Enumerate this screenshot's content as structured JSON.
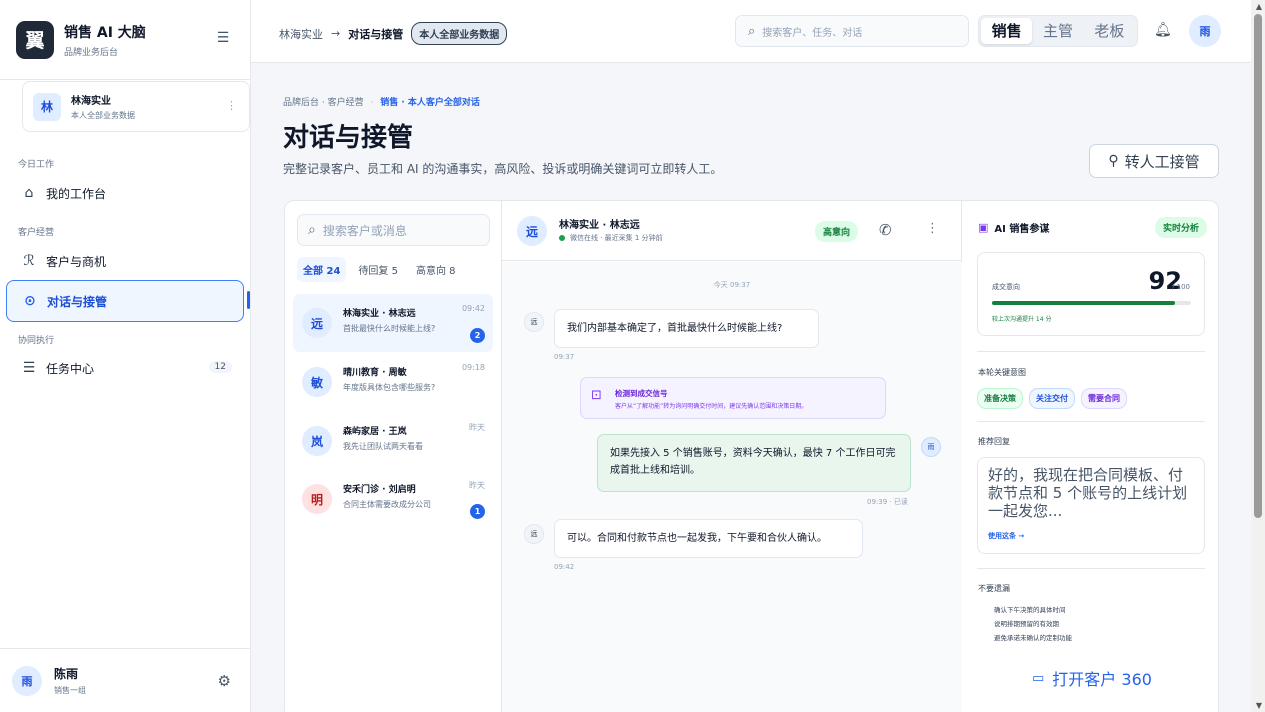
{
  "brand": {
    "logo": "翼",
    "title": "销售 AI 大脑",
    "subtitle": "品牌业务后台"
  },
  "org": {
    "avatar": "林",
    "name": "林海实业",
    "sub": "本人全部业务数据"
  },
  "nav": {
    "section_today": "今日工作",
    "workbench": "我的工作台",
    "section_customer": "客户经营",
    "customers": "客户与商机",
    "conversations": "对话与接管",
    "section_collab": "协同执行",
    "tasks": "任务中心",
    "tasks_count": "12"
  },
  "user": {
    "avatar": "雨",
    "name": "陈雨",
    "team": "销售一组"
  },
  "topbar": {
    "crumb_root": "林海实业",
    "crumb_current": "对话与接管",
    "crumb_tag": "本人全部业务数据",
    "search_placeholder": "搜索客户、任务、对话",
    "roles": [
      "销售",
      "主管",
      "老板"
    ],
    "active_role": "销售",
    "avatar": "雨"
  },
  "page": {
    "crumb": "品牌后台 · 客户经营",
    "crumb_highlight": "销售 · 本人客户全部对话",
    "title": "对话与接管",
    "description": "完整记录客户、员工和 AI 的沟通事实，高风险、投诉或明确关键词可立即转人工。",
    "takeover_label": "转人工接管"
  },
  "list": {
    "search_placeholder": "搜索客户或消息",
    "filters": [
      "全部 24",
      "待回复 5",
      "高意向 8"
    ],
    "conversations": [
      {
        "avatar": "远",
        "name": "林海实业 · 林志远",
        "message": "首批最快什么时候能上线?",
        "time": "09:42",
        "badge": "2"
      },
      {
        "avatar": "敏",
        "name": "晴川教育 · 周敏",
        "message": "年度版具体包含哪些服务?",
        "time": "09:18",
        "badge": ""
      },
      {
        "avatar": "岚",
        "name": "森屿家居 · 王岚",
        "message": "我先让团队试两天看看",
        "time": "昨天",
        "badge": ""
      },
      {
        "avatar": "明",
        "name": "安禾门诊 · 刘启明",
        "message": "合同主体需要改成分公司",
        "time": "昨天",
        "badge": "1"
      }
    ]
  },
  "chat": {
    "avatar": "远",
    "name": "林海实业 · 林志远",
    "status": "微信在线 · 最近采集 1 分钟前",
    "intent": "高意向",
    "day": "今天 09:37",
    "messages": [
      {
        "avatar": "远",
        "text": "我们内部基本确定了，首批最快什么时候能上线?",
        "time": "09:37"
      },
      {
        "avatar": "雨",
        "text": "如果先接入 5 个销售账号，资料今天确认，最快 7 个工作日可完成首批上线和培训。",
        "time": "09:39 · 已读"
      },
      {
        "avatar": "远",
        "text": "可以。合同和付款节点也一起发我，下午要和合伙人确认。",
        "time": "09:42"
      }
    ],
    "signal_title": "检测到成交信号",
    "signal_desc": "客户从“了解功能”转为询问明确交付时间，建议先确认范围和决策日期。"
  },
  "ai": {
    "title": "AI 销售参谋",
    "live": "实时分析",
    "score_label": "成交意向",
    "score": "92",
    "score_max": "/ 100",
    "score_fraction": 0.92,
    "score_note": "较上次沟通提升 14 分",
    "intent_title": "本轮关键意图",
    "tags": [
      "准备决策",
      "关注交付",
      "需要合同"
    ],
    "reply_title": "推荐回复",
    "reply_text": "好的，我现在把合同模板、付款节点和 5 个账号的上线计划一起发您...",
    "reply_use": "使用这条 →",
    "todo_title": "不要遗漏",
    "todos": [
      "确认下午决策的具体时间",
      "说明排期预留的有效期",
      "避免承诺未确认的定制功能"
    ],
    "open360": "打开客户 360"
  },
  "colors": {
    "accent": "#2563eb",
    "success": "#15803d",
    "purple": "#7c3aed"
  }
}
